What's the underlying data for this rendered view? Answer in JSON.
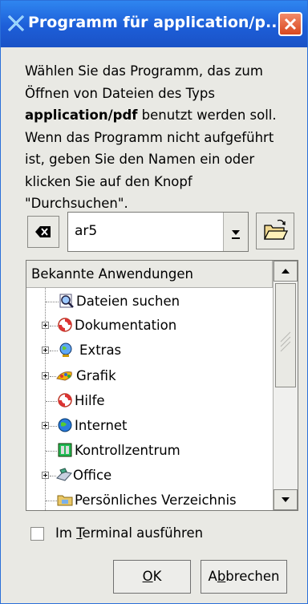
{
  "window": {
    "title": "Programm für application/p...",
    "colors": {
      "titlebar": "#1d5ed8",
      "close": "#d9471e",
      "face": "#e9e9e4"
    }
  },
  "description": {
    "line1": "Wählen Sie das Programm, das zum",
    "line2": "Öffnen von Dateien des Typs",
    "mime": "application/pdf",
    "line3_rest": " benutzt werden soll.",
    "line4": "Wenn das Programm nicht aufgeführt",
    "line5": "ist, geben Sie den Namen ein oder",
    "line6": "klicken Sie auf den Knopf",
    "line7": "\"Durchsuchen\"."
  },
  "command": {
    "value": "ar5"
  },
  "tree": {
    "header": "Bekannte Anwendungen",
    "items": [
      {
        "label": "Dateien suchen",
        "icon": "search-file-icon"
      },
      {
        "label": "Dokumentation",
        "icon": "lifebuoy-icon"
      },
      {
        "label": "Extras",
        "icon": "globe-icon"
      },
      {
        "label": "Grafik",
        "icon": "paint-icon"
      },
      {
        "label": "Hilfe",
        "icon": "lifebuoy-icon"
      },
      {
        "label": "Internet",
        "icon": "globe-icon"
      },
      {
        "label": "Kontrollzentrum",
        "icon": "control-center-icon"
      },
      {
        "label": "Office",
        "icon": "office-icon"
      },
      {
        "label": "Persönliches Verzeichnis",
        "icon": "folder-icon"
      }
    ]
  },
  "terminal": {
    "mnemonic_pre": "Im ",
    "mnemonic_char": "T",
    "mnemonic_post": "erminal ausführen"
  },
  "buttons": {
    "ok_char": "O",
    "ok_rest": "K",
    "cancel_pre": "A",
    "cancel_char": "b",
    "cancel_post": "brechen"
  }
}
